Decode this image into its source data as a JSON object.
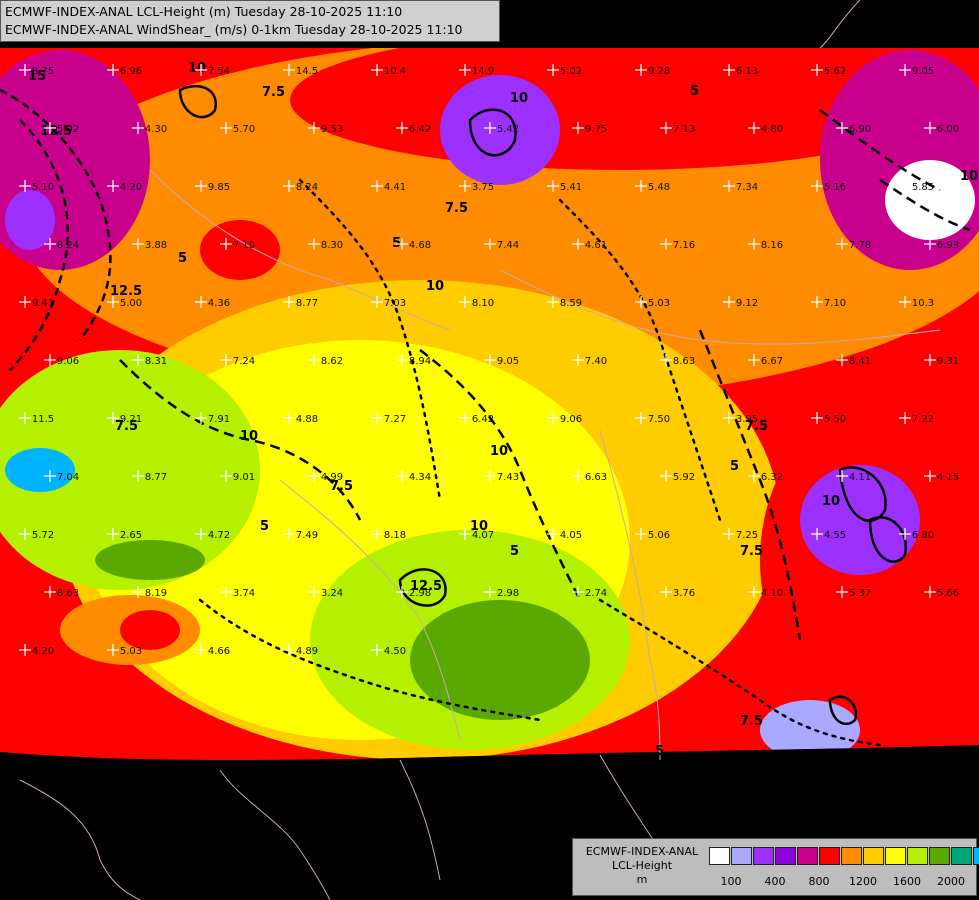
{
  "header": {
    "line1": "ECMWF-INDEX-ANAL LCL-Height (m) Tuesday 28-10-2025 11:10",
    "line2": "ECMWF-INDEX-ANAL WindShear_ (m/s) 0-1km Tuesday 28-10-2025 11:10"
  },
  "legend": {
    "title1": "ECMWF-INDEX-ANAL",
    "title2": "LCL-Height",
    "title3": "m",
    "swatches": [
      "#ffffff",
      "#a9a9ff",
      "#9b30ff",
      "#8a00d8",
      "#c8008c",
      "#ff0000",
      "#ff8c00",
      "#ffcc00",
      "#ffff00",
      "#b4f000",
      "#5aa800",
      "#00a878",
      "#00b4ff"
    ],
    "ticks": [
      "100",
      "400",
      "800",
      "1200",
      "1600",
      "2000"
    ]
  },
  "colors": {
    "white": "#ffffff",
    "lavender": "#a9a9ff",
    "purple": "#9b30ff",
    "magenta": "#c8008c",
    "red": "#ff0000",
    "orange": "#ff8c00",
    "gold": "#ffcc00",
    "yellow": "#ffff00",
    "lime": "#b4f000",
    "green": "#5aa800",
    "teal": "#00a878",
    "cyan": "#00b4ff",
    "background": "#000000"
  },
  "contour_labels": [
    "15",
    "12.5",
    "10",
    "7.5",
    "5",
    "10",
    "7.5",
    "5",
    "10",
    "12.5",
    "7.5",
    "10",
    "5",
    "7.5",
    "10",
    "5",
    "12.5",
    "10",
    "7.5",
    "5",
    "7.5",
    "10",
    "5",
    "7.5",
    "5",
    "10"
  ],
  "station_values": [
    "8.75",
    "6.96",
    "7.54",
    "14.5",
    "10.4",
    "14.9",
    "5.02",
    "9.28",
    "6.13",
    "5.62",
    "9.05",
    "5.02",
    "4.30",
    "5.70",
    "9.53",
    "6.42",
    "5.42",
    "9.75",
    "7.13",
    "4.80",
    "6.90",
    "6.00",
    "5.10",
    "4.20",
    "9.85",
    "8.24",
    "4.41",
    "3.75",
    "5.41",
    "5.48",
    "7.34",
    "5.16",
    "5.85",
    "8.24",
    "3.88",
    "7.10",
    "8.30",
    "4.68",
    "7.44",
    "4.61",
    "7.16",
    "8.16",
    "7.78",
    "6.93",
    "9.41",
    "5.00",
    "4.36",
    "8.77",
    "7.03",
    "8.10",
    "8.59",
    "5.03",
    "9.12",
    "7.10",
    "10.3",
    "9.06",
    "8.31",
    "7.24",
    "8.62",
    "8.94",
    "9.05",
    "7.40",
    "8.63",
    "6.67",
    "8.41",
    "9.31",
    "11.5",
    "9.21",
    "7.91",
    "4.88",
    "7.27",
    "6.42",
    "9.06",
    "7.50",
    "3.95",
    "5.50",
    "7.22",
    "7.04",
    "8.77",
    "9.01",
    "4.99",
    "4.34",
    "7.43",
    "6.63",
    "5.92",
    "6.32",
    "4.11",
    "4.15",
    "5.72",
    "2.65",
    "4.72",
    "7.49",
    "8.18",
    "4.07",
    "4.05",
    "5.06",
    "7.25",
    "4.55",
    "6.80",
    "8.63",
    "8.19",
    "3.74",
    "3.24",
    "2.98",
    "2.98",
    "2.74",
    "3.76",
    "4.10",
    "5.37",
    "5.66",
    "4.20",
    "5.03",
    "4.66",
    "4.89",
    "4.50"
  ]
}
